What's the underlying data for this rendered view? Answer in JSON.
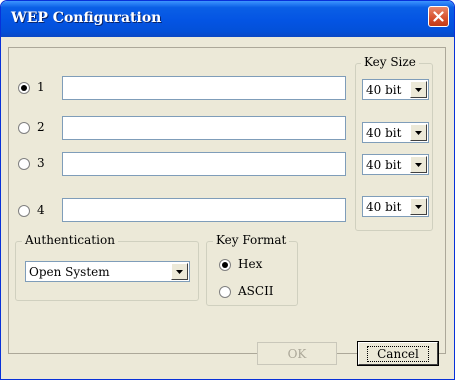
{
  "window": {
    "title": "WEP Configuration"
  },
  "keys": [
    {
      "label": "1",
      "value": "",
      "size": "40 bit",
      "selected": true
    },
    {
      "label": "2",
      "value": "",
      "size": "40 bit",
      "selected": false
    },
    {
      "label": "3",
      "value": "",
      "size": "40 bit",
      "selected": false
    },
    {
      "label": "4",
      "value": "",
      "size": "40 bit",
      "selected": false
    }
  ],
  "key_size": {
    "legend": "Key Size"
  },
  "authentication": {
    "legend": "Authentication",
    "selected": "Open System"
  },
  "key_format": {
    "legend": "Key Format",
    "options": [
      {
        "label": "Hex",
        "selected": true
      },
      {
        "label": "ASCII",
        "selected": false
      }
    ]
  },
  "buttons": {
    "ok": "OK",
    "cancel": "Cancel"
  },
  "colors": {
    "titlebar": "#0454e3",
    "close": "#d7502d",
    "dialog": "#ece9d8",
    "input_border": "#7f9db9"
  },
  "icons": {
    "close": "close-icon",
    "dropdown": "chevron-down-icon"
  }
}
